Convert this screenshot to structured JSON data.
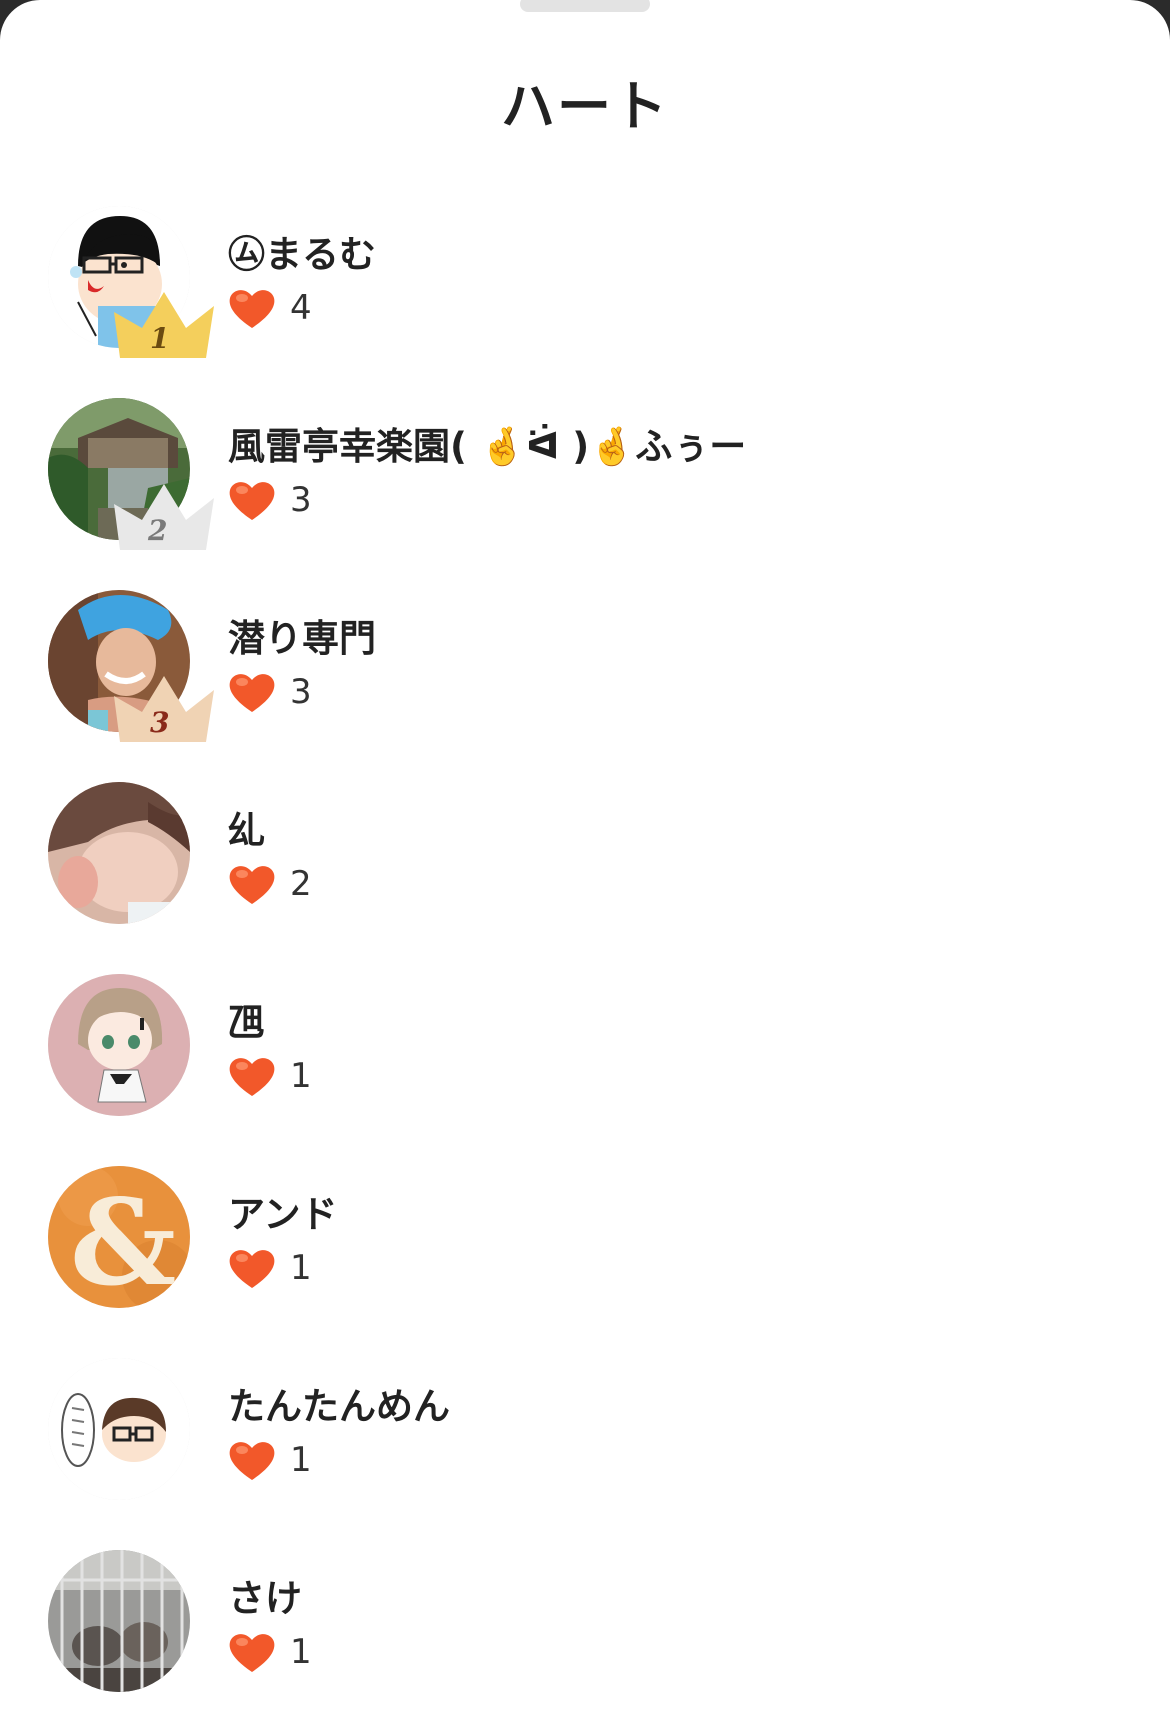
{
  "sheet": {
    "title": "ハート"
  },
  "users": [
    {
      "name": "㋰まるむ",
      "hearts": "4",
      "rank": "1",
      "avatar": "cartoon-glasses-man"
    },
    {
      "name": "風雷亭幸楽園( 🤞ᐛ )🤞ふぅー",
      "hearts": "3",
      "rank": "2",
      "avatar": "village-landscape"
    },
    {
      "name": "潜り専門",
      "hearts": "3",
      "rank": "3",
      "avatar": "blue-hat-woman"
    },
    {
      "name": "乣",
      "hearts": "2",
      "rank": "",
      "avatar": "blurred-photo"
    },
    {
      "name": "乪",
      "hearts": "1",
      "rank": "",
      "avatar": "anime-girl"
    },
    {
      "name": "アンド",
      "hearts": "1",
      "rank": "",
      "avatar": "ampersand"
    },
    {
      "name": "たんたんめん",
      "hearts": "1",
      "rank": "",
      "avatar": "cartoon-boy-speech"
    },
    {
      "name": "さけ",
      "hearts": "1",
      "rank": "",
      "avatar": "cage-animals"
    }
  ],
  "colors": {
    "heart": "#f2582a",
    "gold": "#f4cf5c",
    "silver": "#e8e8e8",
    "bronze": "#f0d3b4"
  }
}
